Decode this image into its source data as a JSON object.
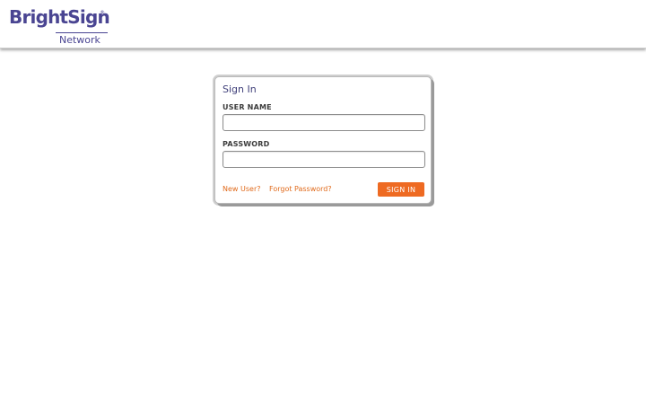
{
  "header": {
    "logo": {
      "main": "BrightSign",
      "reg": "®",
      "sub": "Network"
    }
  },
  "signin": {
    "title": "Sign In",
    "username_label": "USER NAME",
    "username_value": "",
    "password_label": "PASSWORD",
    "password_value": "",
    "new_user_link": "New User?",
    "forgot_link": "Forgot Password?",
    "submit_label": "SIGN IN"
  },
  "colors": {
    "brand": "#4a4592",
    "accent": "#ee6a22",
    "link": "#e06a1b"
  }
}
